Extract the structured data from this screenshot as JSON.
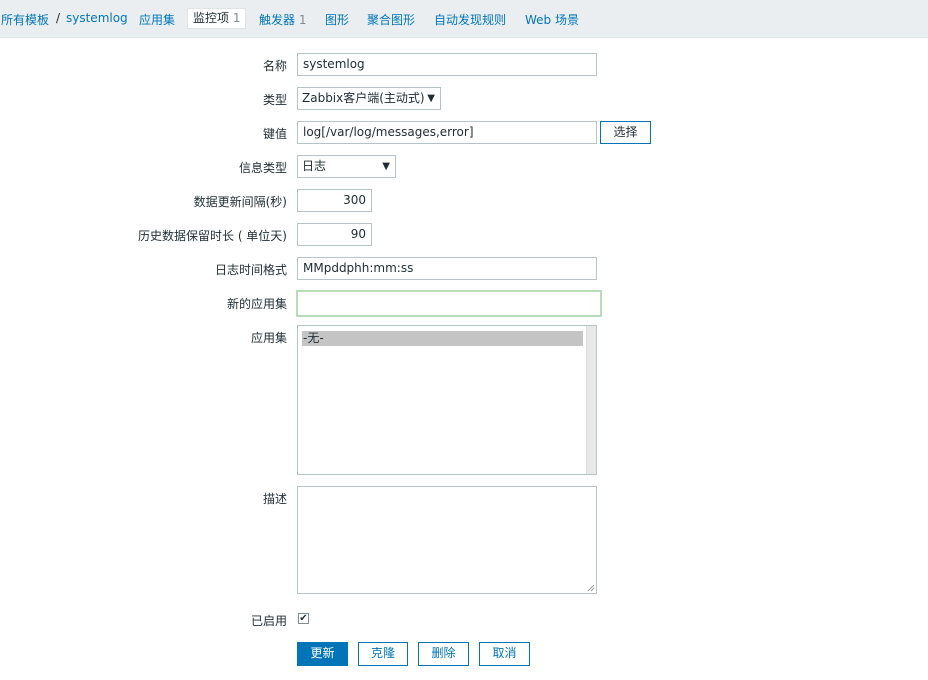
{
  "nav": {
    "all_templates": "所有模板",
    "separator": "/",
    "template_name": "systemlog",
    "applications": "应用集",
    "items": "监控项",
    "items_count": "1",
    "triggers": "触发器",
    "triggers_count": "1",
    "graphs": "图形",
    "screens": "聚合图形",
    "discovery": "自动发现规则",
    "web": "Web 场景"
  },
  "form": {
    "name_label": "名称",
    "name_value": "systemlog",
    "type_label": "类型",
    "type_value": "Zabbix客户端(主动式)",
    "key_label": "键值",
    "key_value": "log[/var/log/messages,error]",
    "select_button": "选择",
    "info_type_label": "信息类型",
    "info_type_value": "日志",
    "interval_label": "数据更新间隔(秒)",
    "interval_value": "300",
    "history_label": "历史数据保留时长 ( 单位天)",
    "history_value": "90",
    "log_format_label": "日志时间格式",
    "log_format_value": "MMpddphh:mm:ss",
    "new_app_label": "新的应用集",
    "new_app_value": "",
    "apps_label": "应用集",
    "apps_options": [
      "-无-"
    ],
    "description_label": "描述",
    "description_value": "",
    "enabled_label": "已启用",
    "enabled": true
  },
  "buttons": {
    "update": "更新",
    "clone": "克隆",
    "delete": "删除",
    "cancel": "取消"
  },
  "icons": {
    "dropdown": "caret-down-icon",
    "checkbox": "checkmark-icon"
  }
}
